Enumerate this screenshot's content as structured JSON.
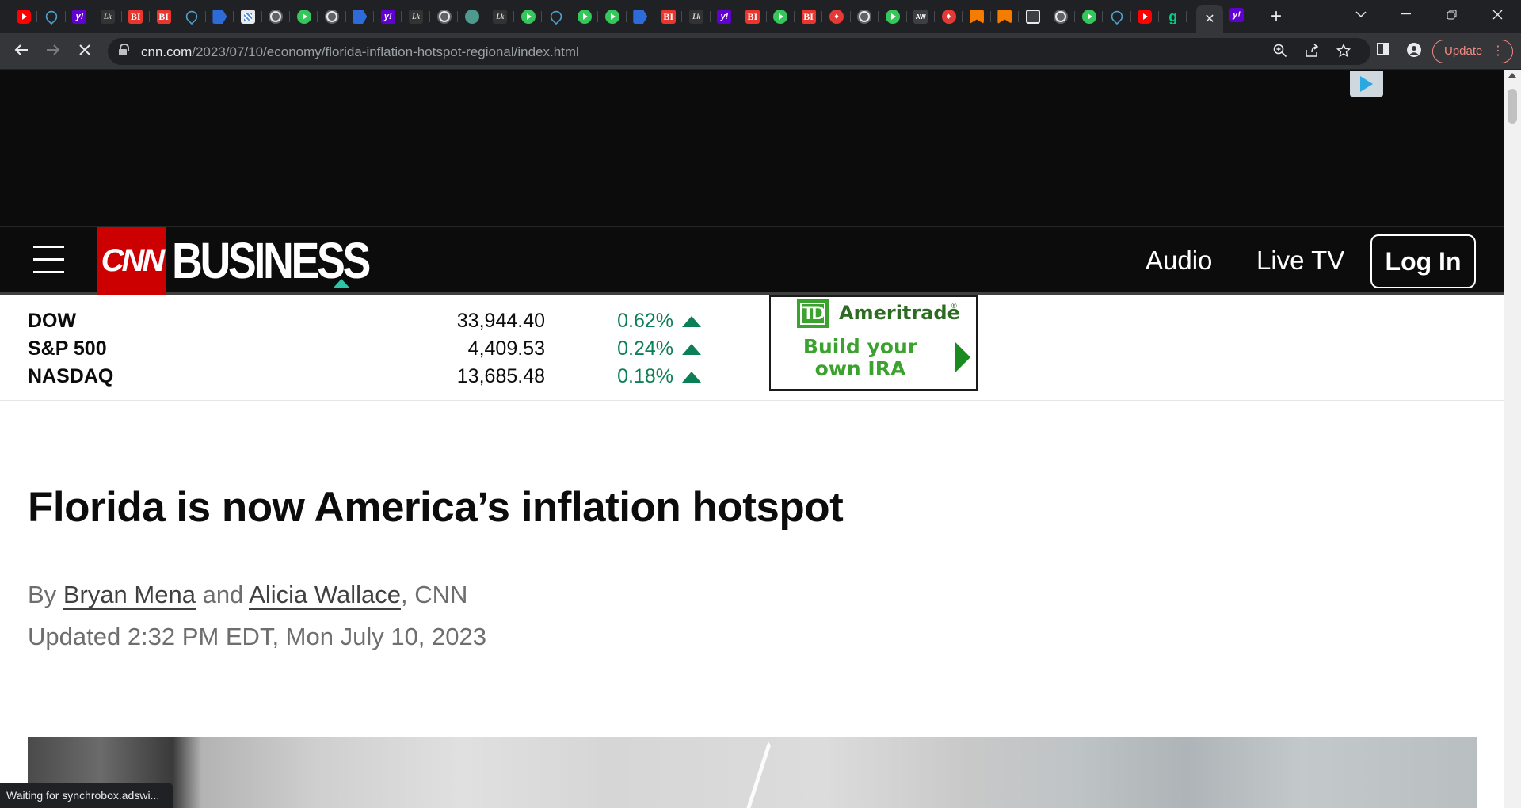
{
  "browser": {
    "tab_favicons": [
      "youtube-icon",
      "shield-icon",
      "yahoo-icon",
      "wsj-icon",
      "bi-icon",
      "bi-icon",
      "shield-icon",
      "flag-icon",
      "grid-icon",
      "globe-icon",
      "play-icon",
      "globe-icon",
      "flag-icon",
      "yahoo-icon",
      "wsj-icon",
      "globe-icon",
      "tree-icon",
      "wsj-icon",
      "play-icon",
      "shield-icon",
      "play-icon",
      "play-icon",
      "flag-icon",
      "bi-icon",
      "wsj-icon",
      "yahoo-icon",
      "bi-icon",
      "play-icon",
      "bi-icon",
      "red-icon",
      "globe-icon",
      "play-icon",
      "dark-icon",
      "red-icon",
      "bookmark-icon",
      "bookmark-icon",
      "house-icon",
      "globe-icon",
      "play-icon",
      "shield-icon",
      "youtube-icon",
      "g-icon"
    ],
    "fav_labels": {
      "yahoo": "y!",
      "bi": "BI",
      "wsj": "Lk",
      "red": "♦",
      "g": "g",
      "dark": "AW"
    },
    "active_tab_close": "✕",
    "after_tab_icon": "yahoo-icon",
    "new_tab": "+",
    "url_host": "cnn.com",
    "url_path": "/2023/07/10/economy/florida-inflation-hotspot-regional/index.html",
    "update_label": "Update",
    "status_text": "Waiting for synchrobox.adswi..."
  },
  "header": {
    "logo_text": "CNN",
    "section_word": "BUSINESS",
    "nav": [
      "Audio",
      "Live TV"
    ],
    "login_label": "Log In"
  },
  "markets": [
    {
      "name": "DOW",
      "value": "33,944.40",
      "change": "0.62%",
      "direction": "up"
    },
    {
      "name": "S&P 500",
      "value": "4,409.53",
      "change": "0.24%",
      "direction": "up"
    },
    {
      "name": "NASDAQ",
      "value": "13,685.48",
      "change": "0.18%",
      "direction": "up"
    }
  ],
  "ad": {
    "brand_mark": "TD",
    "brand_name": "Ameritrade",
    "registered": "®",
    "cta_line1": "Build your",
    "cta_line2": "own IRA"
  },
  "article": {
    "headline": "Florida is now America’s inflation hotspot",
    "by_prefix": "By",
    "author1": "Bryan Mena",
    "and": "and",
    "author2": "Alicia Wallace",
    "source": ", CNN",
    "updated": "Updated 2:32 PM EDT, Mon July 10, 2023"
  },
  "colors": {
    "cnn_red": "#cc0000",
    "market_up": "#0d7f56",
    "header_bg": "#0c0c0c",
    "td_green": "#3ba12f"
  }
}
